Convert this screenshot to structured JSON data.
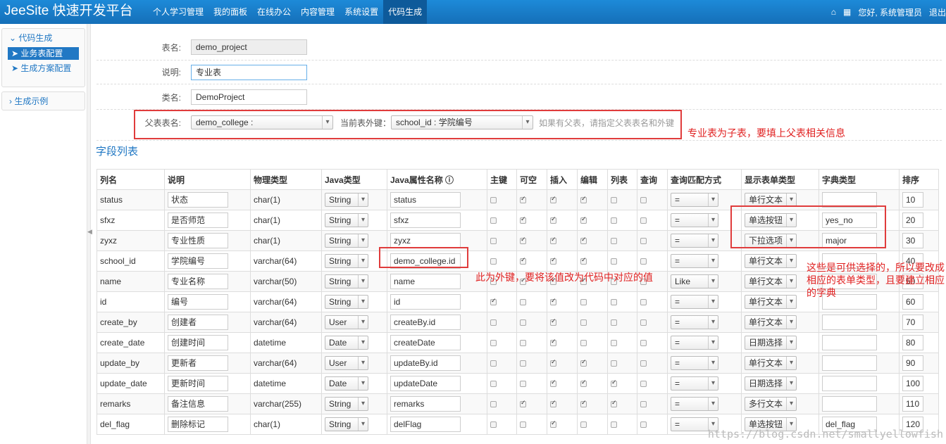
{
  "header": {
    "brand": "JeeSite 快速开发平台",
    "nav": [
      "个人学习管理",
      "我的面板",
      "在线办公",
      "内容管理",
      "系统设置",
      "代码生成"
    ],
    "active_nav": 5,
    "home_icon": "home-icon",
    "apps_icon": "grid-icon",
    "greeting": "您好, 系统管理员",
    "logout": "退出"
  },
  "sidebar": {
    "group1_title": "代码生成",
    "items": [
      "业务表配置",
      "生成方案配置"
    ],
    "group2_title": "生成示例"
  },
  "form": {
    "table_name_label": "表名:",
    "table_name": "demo_project",
    "comment_label": "说明:",
    "comment": "专业表",
    "class_label": "类名:",
    "class_name": "DemoProject",
    "parent_label": "父表表名:",
    "parent_table": "demo_college :",
    "fk_label": "当前表外键：",
    "fk_value": "school_id : 学院编号",
    "parent_hint": "如果有父表，请指定父表表名和外键"
  },
  "section_title": "字段列表",
  "columns": [
    "列名",
    "说明",
    "物理类型",
    "Java类型",
    "Java属性名称",
    "主键",
    "可空",
    "插入",
    "编辑",
    "列表",
    "查询",
    "查询匹配方式",
    "显示表单类型",
    "字典类型",
    "排序"
  ],
  "rows": [
    {
      "name": "status",
      "comment": "状态",
      "jdbc": "char(1)",
      "java": "String",
      "field": "status",
      "pk": false,
      "nullable": true,
      "insert": true,
      "edit": true,
      "list": false,
      "query": false,
      "match": "=",
      "show": "单行文本",
      "dict": "",
      "sort": "10"
    },
    {
      "name": "sfxz",
      "comment": "是否师范",
      "jdbc": "char(1)",
      "java": "String",
      "field": "sfxz",
      "pk": false,
      "nullable": true,
      "insert": true,
      "edit": true,
      "list": false,
      "query": false,
      "match": "=",
      "show": "单选按钮",
      "dict": "yes_no",
      "sort": "20"
    },
    {
      "name": "zyxz",
      "comment": "专业性质",
      "jdbc": "char(1)",
      "java": "String",
      "field": "zyxz",
      "pk": false,
      "nullable": true,
      "insert": true,
      "edit": true,
      "list": false,
      "query": false,
      "match": "=",
      "show": "下拉选项",
      "dict": "major",
      "sort": "30"
    },
    {
      "name": "school_id",
      "comment": "学院编号",
      "jdbc": "varchar(64)",
      "java": "String",
      "field": "demo_college.id",
      "pk": false,
      "nullable": true,
      "insert": true,
      "edit": true,
      "list": false,
      "query": false,
      "match": "=",
      "show": "单行文本",
      "dict": "",
      "sort": "40"
    },
    {
      "name": "name",
      "comment": "专业名称",
      "jdbc": "varchar(50)",
      "java": "String",
      "field": "name",
      "pk": false,
      "nullable": true,
      "insert": true,
      "edit": true,
      "list": false,
      "query": false,
      "match": "Like",
      "show": "单行文本",
      "dict": "",
      "sort": "50"
    },
    {
      "name": "id",
      "comment": "编号",
      "jdbc": "varchar(64)",
      "java": "String",
      "field": "id",
      "pk": true,
      "nullable": false,
      "insert": true,
      "edit": false,
      "list": false,
      "query": false,
      "match": "=",
      "show": "单行文本",
      "dict": "",
      "sort": "60"
    },
    {
      "name": "create_by",
      "comment": "创建者",
      "jdbc": "varchar(64)",
      "java": "User",
      "field": "createBy.id",
      "pk": false,
      "nullable": false,
      "insert": true,
      "edit": false,
      "list": false,
      "query": false,
      "match": "=",
      "show": "单行文本",
      "dict": "",
      "sort": "70"
    },
    {
      "name": "create_date",
      "comment": "创建时间",
      "jdbc": "datetime",
      "java": "Date",
      "field": "createDate",
      "pk": false,
      "nullable": false,
      "insert": true,
      "edit": false,
      "list": false,
      "query": false,
      "match": "=",
      "show": "日期选择",
      "dict": "",
      "sort": "80"
    },
    {
      "name": "update_by",
      "comment": "更新者",
      "jdbc": "varchar(64)",
      "java": "User",
      "field": "updateBy.id",
      "pk": false,
      "nullable": false,
      "insert": true,
      "edit": true,
      "list": false,
      "query": false,
      "match": "=",
      "show": "单行文本",
      "dict": "",
      "sort": "90"
    },
    {
      "name": "update_date",
      "comment": "更新时间",
      "jdbc": "datetime",
      "java": "Date",
      "field": "updateDate",
      "pk": false,
      "nullable": false,
      "insert": true,
      "edit": true,
      "list": true,
      "query": false,
      "match": "=",
      "show": "日期选择",
      "dict": "",
      "sort": "100"
    },
    {
      "name": "remarks",
      "comment": "备注信息",
      "jdbc": "varchar(255)",
      "java": "String",
      "field": "remarks",
      "pk": false,
      "nullable": true,
      "insert": true,
      "edit": true,
      "list": true,
      "query": false,
      "match": "=",
      "show": "多行文本",
      "dict": "",
      "sort": "110"
    },
    {
      "name": "del_flag",
      "comment": "删除标记",
      "jdbc": "char(1)",
      "java": "String",
      "field": "delFlag",
      "pk": false,
      "nullable": false,
      "insert": true,
      "edit": false,
      "list": false,
      "query": false,
      "match": "=",
      "show": "单选按钮",
      "dict": "del_flag",
      "sort": "120"
    }
  ],
  "annotations": {
    "parent": "专业表为子表，要填上父表相关信息",
    "fk": "此为外键，要将该值改为代码中对应的值",
    "dict": "这些是可供选择的，所以要改成相应的表单类型，且要建立相应的字典"
  },
  "watermark": "https://blog.csdn.net/smallyellowfish",
  "colors": {
    "header": "#1a7fcb",
    "accent": "#2178c4",
    "annotation": "#e03c3c"
  }
}
